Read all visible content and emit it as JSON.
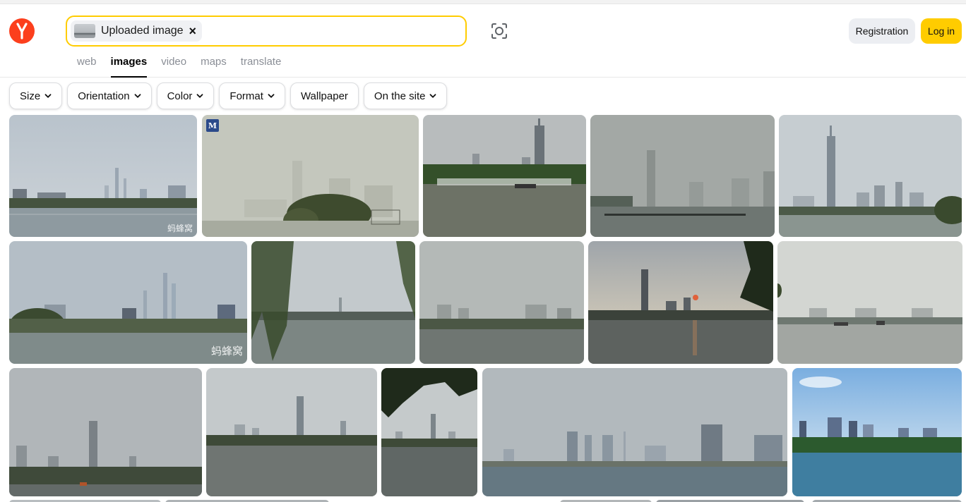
{
  "header": {
    "search": {
      "chip_label": "Uploaded image",
      "chip_close": "×"
    },
    "registration_label": "Registration",
    "login_label": "Log in",
    "tabs": [
      {
        "label": "web"
      },
      {
        "label": "images"
      },
      {
        "label": "video"
      },
      {
        "label": "maps"
      },
      {
        "label": "translate"
      }
    ],
    "active_tab": "images"
  },
  "filters": [
    {
      "label": "Size",
      "dropdown": true
    },
    {
      "label": "Orientation",
      "dropdown": true
    },
    {
      "label": "Color",
      "dropdown": true
    },
    {
      "label": "Format",
      "dropdown": true
    },
    {
      "label": "Wallpaper",
      "dropdown": false
    },
    {
      "label": "On the site",
      "dropdown": true
    }
  ],
  "results": {
    "watermarks": {
      "mafengwo": "蚂蜂窝",
      "mafengwo_small": "蚂蜂窝",
      "badge": "M"
    }
  },
  "colors": {
    "brand_red": "#fc3f1d",
    "accent_yellow": "#ffcc00"
  }
}
